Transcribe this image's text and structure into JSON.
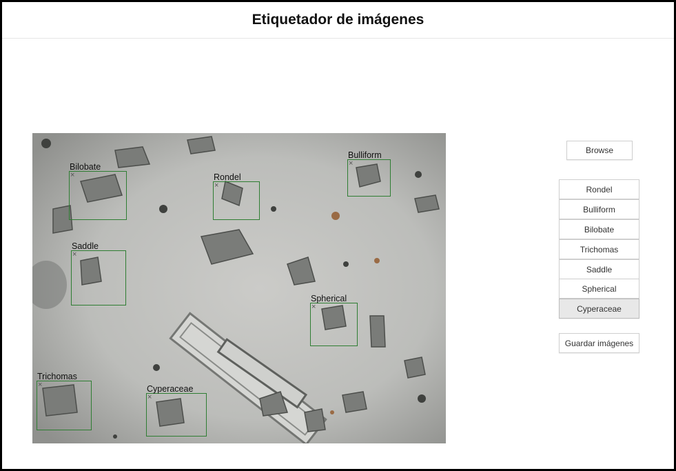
{
  "header": {
    "title": "Etiquetador de imágenes"
  },
  "controls": {
    "browse_label": "Browse",
    "save_label": "Guardar imágenes",
    "labels": [
      {
        "name": "Rondel",
        "active": false
      },
      {
        "name": "Bulliform",
        "active": false
      },
      {
        "name": "Bilobate",
        "active": false
      },
      {
        "name": "Trichomas",
        "active": false
      },
      {
        "name": "Saddle",
        "active": false
      },
      {
        "name": "Spherical",
        "active": false
      },
      {
        "name": "Cyperaceae",
        "active": true
      }
    ]
  },
  "annotations": [
    {
      "label": "Bilobate",
      "close": "×"
    },
    {
      "label": "Rondel",
      "close": "×"
    },
    {
      "label": "Bulliform",
      "close": "×"
    },
    {
      "label": "Saddle",
      "close": "×"
    },
    {
      "label": "Spherical",
      "close": "×"
    },
    {
      "label": "Trichomas",
      "close": "×"
    },
    {
      "label": "Cyperaceae",
      "close": "×"
    }
  ],
  "colors": {
    "box": "#2e7d32",
    "active_button": "#e8e8e8"
  }
}
